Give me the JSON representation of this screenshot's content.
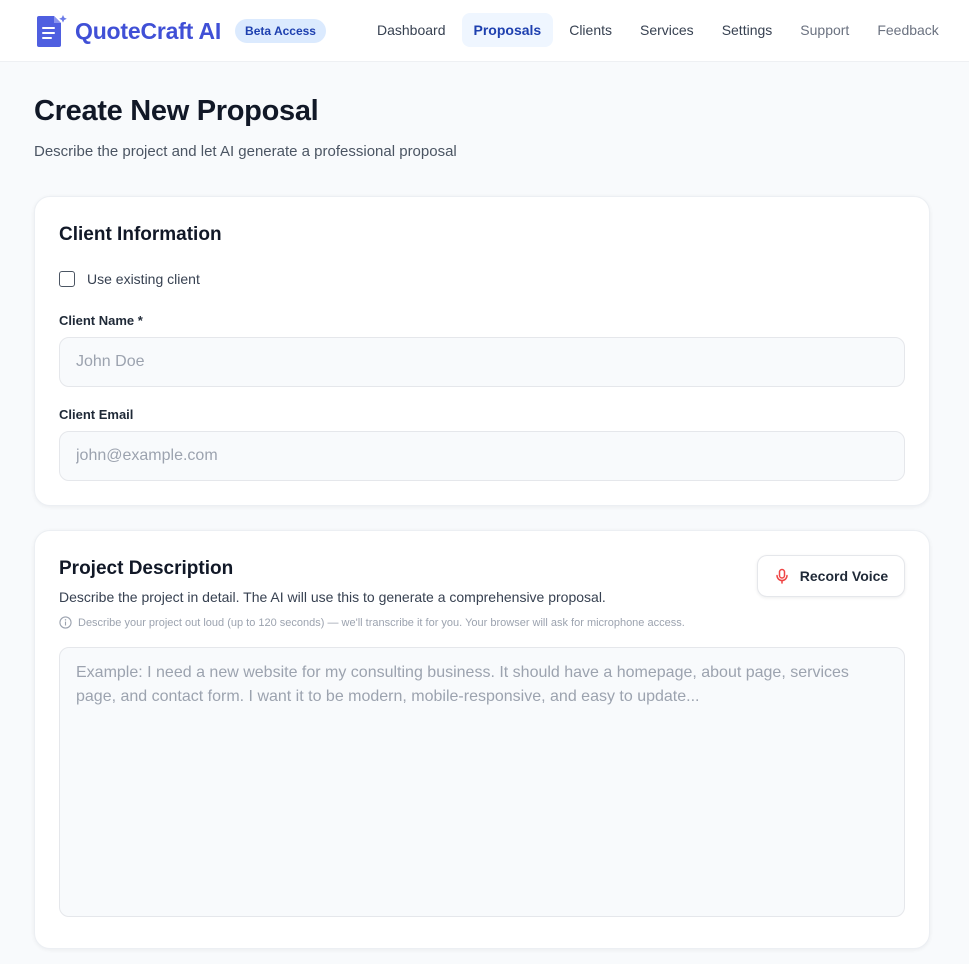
{
  "header": {
    "brand_name": "QuoteCraft AI",
    "beta_badge": "Beta Access",
    "logo_icon": "document-icon",
    "nav": [
      {
        "label": "Dashboard",
        "active": false
      },
      {
        "label": "Proposals",
        "active": true
      },
      {
        "label": "Clients",
        "active": false
      },
      {
        "label": "Services",
        "active": false
      },
      {
        "label": "Settings",
        "active": false
      },
      {
        "label": "Support",
        "active": false
      },
      {
        "label": "Feedback",
        "active": false
      }
    ]
  },
  "page": {
    "title": "Create New Proposal",
    "subtitle": "Describe the project and let AI generate a professional proposal"
  },
  "client_info": {
    "title": "Client Information",
    "use_existing_label": "Use existing client",
    "use_existing_checked": false,
    "name_label": "Client Name *",
    "name_placeholder": "John Doe",
    "name_value": "",
    "email_label": "Client Email",
    "email_placeholder": "john@example.com",
    "email_value": ""
  },
  "project": {
    "title": "Project Description",
    "description": "Describe the project in detail. The AI will use this to generate a comprehensive proposal.",
    "hint": "Describe your project out loud (up to 120 seconds) — we'll transcribe it for you. Your browser will ask for microphone access.",
    "hint_icon": "info-icon",
    "record_button_label": "Record Voice",
    "record_icon": "microphone-icon",
    "textarea_placeholder": "Example: I need a new website for my consulting business. It should have a homepage, about page, services page, and contact form. I want it to be modern, mobile-responsive, and easy to update...",
    "textarea_value": ""
  },
  "colors": {
    "brand": "#4050d6",
    "accent": "#1e40af",
    "badge_bg": "#dbeafe",
    "mic": "#ef4444",
    "page_bg": "#f8fafc"
  }
}
